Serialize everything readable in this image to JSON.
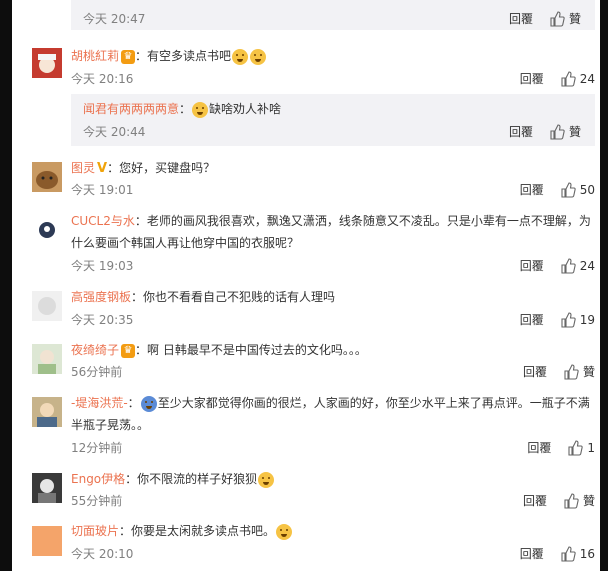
{
  "comments": [
    {
      "user": "",
      "text": "",
      "time": "今天 20:47",
      "reply": "回覆",
      "likes": "贊",
      "nested": true
    },
    {
      "user": "胡桃紅莉",
      "text": "有空多读点书吧",
      "time": "今天 20:16",
      "reply": "回覆",
      "likes": "24"
    },
    {
      "user": "闻君有两两两两意",
      "text": "缺啥劝人补啥",
      "time": "今天 20:44",
      "reply": "回覆",
      "likes": "贊",
      "nested": true
    },
    {
      "user": "图灵",
      "text": "您好，买键盘吗？",
      "time": "今天 19:01",
      "reply": "回覆",
      "likes": "50"
    },
    {
      "user": "CUCL2与水",
      "text": "老师的画风我很喜欢，飘逸又潇洒，线条随意又不凌乱。只是小辈有一点不理解，为什么要画个韩国人再让他穿中国的衣服呢？",
      "time": "今天 19:03",
      "reply": "回覆",
      "likes": "24"
    },
    {
      "user": "高强度钢板",
      "text": "你也不看看自己不犯贱的话有人理吗",
      "time": "今天 20:35",
      "reply": "回覆",
      "likes": "19"
    },
    {
      "user": "夜绮绮子",
      "text": "啊  日韩最早不是中国传过去的文化吗。。。",
      "time": "56分钟前",
      "reply": "回覆",
      "likes": "贊"
    },
    {
      "user": "-堤海洪荒-",
      "text": "至少大家都觉得你画的很烂，人家画的好，你至少水平上来了再点评。一瓶子不满半瓶子晃荡。。",
      "time": "12分钟前",
      "reply": "回覆",
      "likes": "1"
    },
    {
      "user": "Engo伊格",
      "text": "你不限流的样子好狼狈",
      "time": "55分钟前",
      "reply": "回覆",
      "likes": "贊"
    },
    {
      "user": "切面玻片",
      "text": "你要是太闲就多读点书吧。",
      "time": "今天 20:10",
      "reply": "回覆",
      "likes": "16"
    }
  ],
  "colors": {
    "username": "#eb7350",
    "meta": "#808080",
    "nested_bg": "#f2f2f5",
    "frame": "#0d0d0d"
  },
  "icons": {
    "like": "thumbs-up-icon",
    "badge": "vip-badge-icon",
    "verified": "verified-v-icon"
  }
}
